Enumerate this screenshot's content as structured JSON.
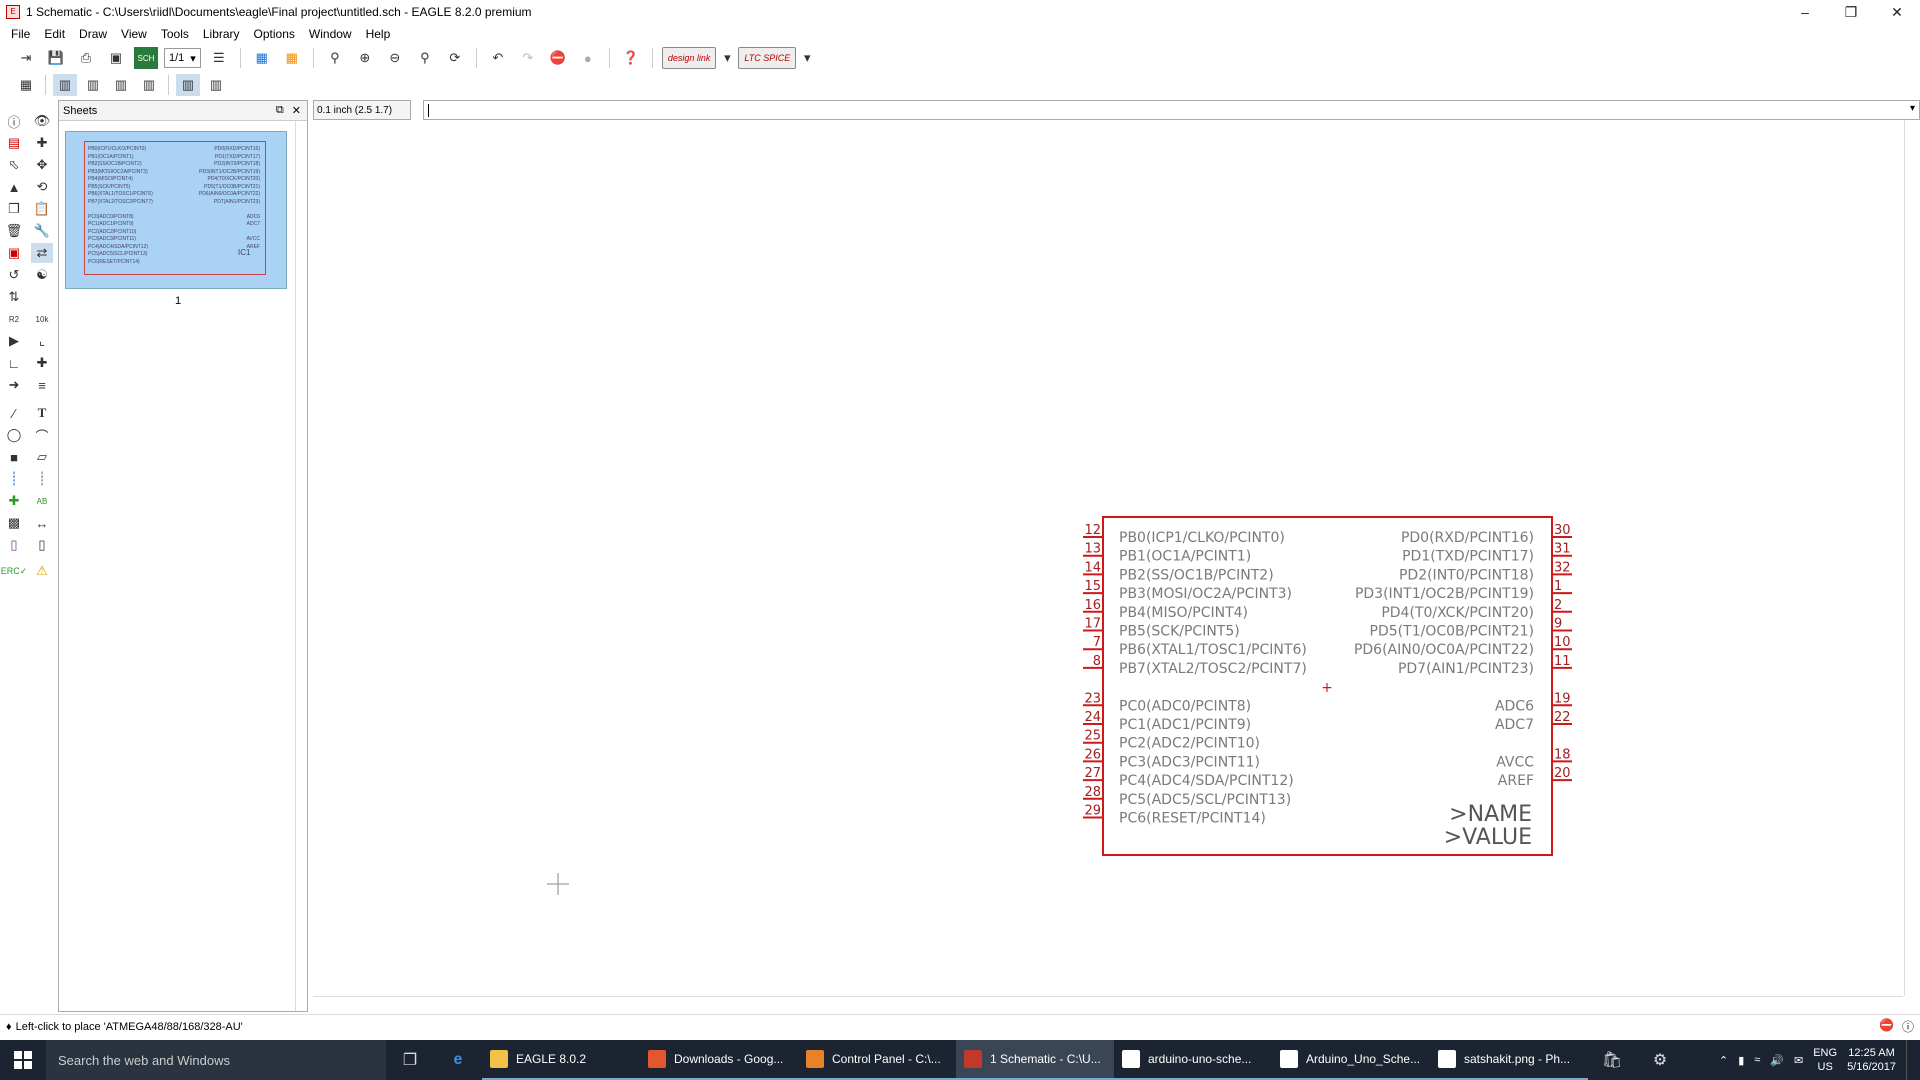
{
  "window": {
    "title": "1 Schematic - C:\\Users\\riidl\\Documents\\eagle\\Final project\\untitled.sch - EAGLE 8.2.0 premium"
  },
  "menu": [
    "File",
    "Edit",
    "Draw",
    "View",
    "Tools",
    "Library",
    "Options",
    "Window",
    "Help"
  ],
  "toolbar": {
    "sheet_select": "1/1",
    "designlink_label": "design link",
    "ltspice_label": "LTC SPICE"
  },
  "sheets_panel": {
    "title": "Sheets",
    "sheet_number": "1"
  },
  "command": {
    "grid_value": "0.1 inch (2.5 1.7)"
  },
  "schematic": {
    "part_name_tag": ">NAME",
    "part_value_tag": ">VALUE",
    "left_pins": [
      {
        "num": "12",
        "label": "PB0(ICP1/CLKO/PCINT0)"
      },
      {
        "num": "13",
        "label": "PB1(OC1A/PCINT1)"
      },
      {
        "num": "14",
        "label": "PB2(SS/OC1B/PCINT2)"
      },
      {
        "num": "15",
        "label": "PB3(MOSI/OC2A/PCINT3)"
      },
      {
        "num": "16",
        "label": "PB4(MISO/PCINT4)"
      },
      {
        "num": "17",
        "label": "PB5(SCK/PCINT5)"
      },
      {
        "num": "7",
        "label": "PB6(XTAL1/TOSC1/PCINT6)"
      },
      {
        "num": "8",
        "label": "PB7(XTAL2/TOSC2/PCINT7)"
      },
      {
        "num": "23",
        "label": "PC0(ADC0/PCINT8)"
      },
      {
        "num": "24",
        "label": "PC1(ADC1/PCINT9)"
      },
      {
        "num": "25",
        "label": "PC2(ADC2/PCINT10)"
      },
      {
        "num": "26",
        "label": "PC3(ADC3/PCINT11)"
      },
      {
        "num": "27",
        "label": "PC4(ADC4/SDA/PCINT12)"
      },
      {
        "num": "28",
        "label": "PC5(ADC5/SCL/PCINT13)"
      },
      {
        "num": "29",
        "label": "PC6(RESET/PCINT14)"
      }
    ],
    "right_pins": [
      {
        "num": "30",
        "label": "PD0(RXD/PCINT16)"
      },
      {
        "num": "31",
        "label": "PD1(TXD/PCINT17)"
      },
      {
        "num": "32",
        "label": "PD2(INT0/PCINT18)"
      },
      {
        "num": "1",
        "label": "PD3(INT1/OC2B/PCINT19)"
      },
      {
        "num": "2",
        "label": "PD4(T0/XCK/PCINT20)"
      },
      {
        "num": "9",
        "label": "PD5(T1/OC0B/PCINT21)"
      },
      {
        "num": "10",
        "label": "PD6(AIN0/OC0A/PCINT22)"
      },
      {
        "num": "11",
        "label": "PD7(AIN1/PCINT23)"
      },
      {
        "num": "19",
        "label": "ADC6"
      },
      {
        "num": "22",
        "label": "ADC7"
      },
      {
        "num": "18",
        "label": "AVCC"
      },
      {
        "num": "20",
        "label": "AREF"
      }
    ],
    "thumb_ref": "IC1"
  },
  "status": {
    "message": "Left-click to place 'ATMEGA48/88/168/328-AU'"
  },
  "taskbar": {
    "search_placeholder": "Search the web and Windows",
    "tasks": [
      {
        "label": "EAGLE 8.0.2",
        "icon": "folder-icon",
        "color": "#f3c04a"
      },
      {
        "label": "Downloads - Goog...",
        "icon": "chrome-icon",
        "color": "#e4572e"
      },
      {
        "label": "Control Panel - C:\\...",
        "icon": "eagle-icon",
        "color": "#e8822a"
      },
      {
        "label": "1 Schematic - C:\\U...",
        "icon": "schematic-icon",
        "color": "#c0392b"
      },
      {
        "label": "arduino-uno-sche...",
        "icon": "image-icon",
        "color": "#ffffff"
      },
      {
        "label": "Arduino_Uno_Sche...",
        "icon": "image-icon",
        "color": "#ffffff"
      },
      {
        "label": "satshakit.png - Ph...",
        "icon": "image-icon",
        "color": "#ffffff"
      }
    ],
    "lang": "ENG",
    "region": "US",
    "time": "12:25 AM",
    "date": "5/16/2017"
  }
}
